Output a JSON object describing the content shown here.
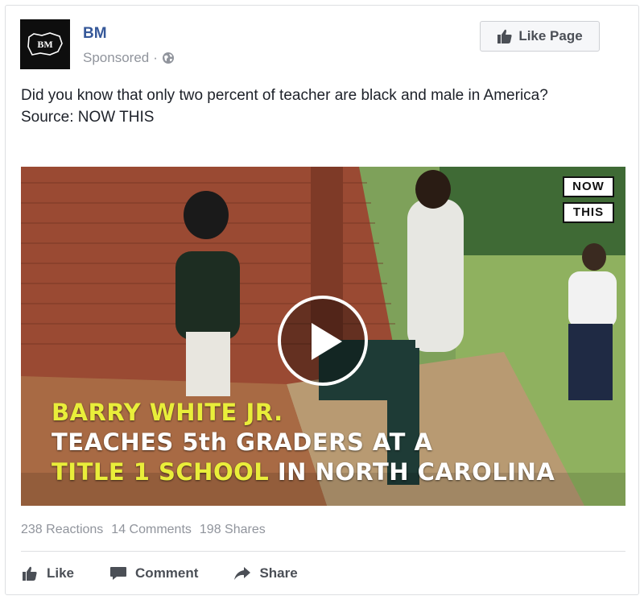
{
  "post": {
    "page_name": "BM",
    "avatar_text": "BM",
    "sponsored": "Sponsored",
    "separator": "·",
    "privacy_icon": "globe-icon",
    "like_page_label": "Like Page",
    "text_line1": "Did you know that only two percent of teacher are black and male in America?",
    "text_line2": "Source: NOW THIS"
  },
  "video": {
    "badge_top": "NOW",
    "badge_bottom": "THIS",
    "play_icon": "play-icon",
    "caption_line1": "BARRY WHITE JR.",
    "caption_line2": "TEACHES 5th GRADERS AT A",
    "caption_line3_highlight": "TITLE 1 SCHOOL",
    "caption_line3_rest": " IN NORTH CAROLINA",
    "caption_highlight_color": "#e9ee3a"
  },
  "stats": {
    "reactions": "238 Reactions",
    "comments": "14 Comments",
    "shares": "198 Shares"
  },
  "actions": {
    "like": "Like",
    "comment": "Comment",
    "share": "Share"
  },
  "colors": {
    "page_name": "#365899",
    "secondary_text": "#90949c",
    "action_text": "#4b4f56"
  }
}
